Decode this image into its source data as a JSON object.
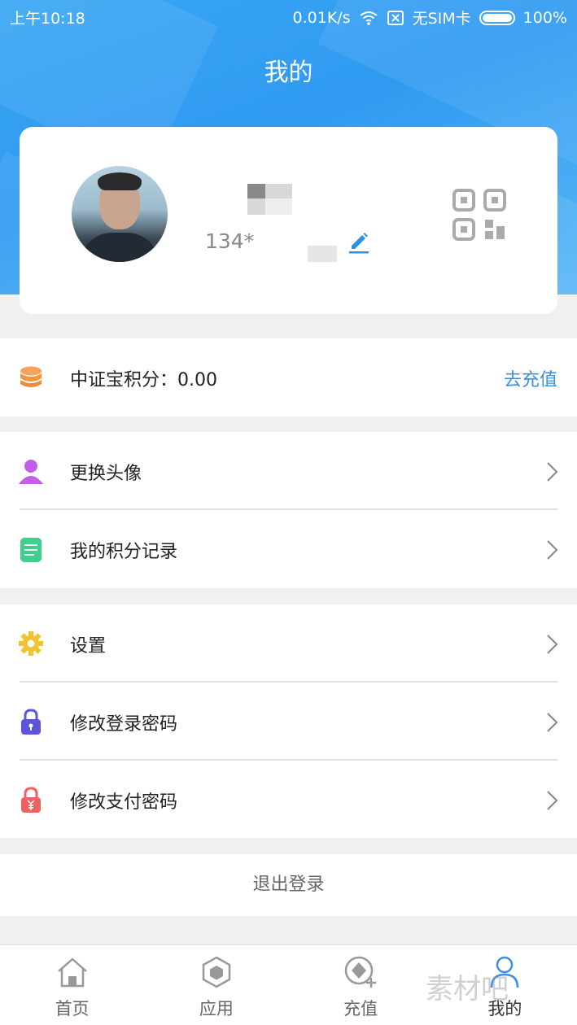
{
  "status_bar": {
    "time": "上午10:18",
    "speed": "0.01K/s",
    "sim": "无SIM卡",
    "battery": "100%"
  },
  "header": {
    "title": "我的"
  },
  "profile": {
    "phone": "134*"
  },
  "points_row": {
    "label": "中证宝积分：0.00",
    "action": "去充值"
  },
  "menu_group1": [
    {
      "label": "更换头像",
      "icon": "user-icon"
    },
    {
      "label": "我的积分记录",
      "icon": "notepad-icon"
    }
  ],
  "menu_group2": [
    {
      "label": "设置",
      "icon": "gear-icon"
    },
    {
      "label": "修改登录密码",
      "icon": "lock-icon"
    },
    {
      "label": "修改支付密码",
      "icon": "payment-lock-icon"
    }
  ],
  "logout": {
    "label": "退出登录"
  },
  "tabbar": [
    {
      "label": "首页",
      "icon": "home-icon"
    },
    {
      "label": "应用",
      "icon": "cube-icon"
    },
    {
      "label": "充值",
      "icon": "recharge-icon"
    },
    {
      "label": "我的",
      "icon": "profile-icon",
      "active": true
    }
  ],
  "watermark": "素材吧",
  "colors": {
    "header_blue": "#2f9af0",
    "link_blue": "#3a8fe0",
    "background": "#f0f0f0"
  }
}
